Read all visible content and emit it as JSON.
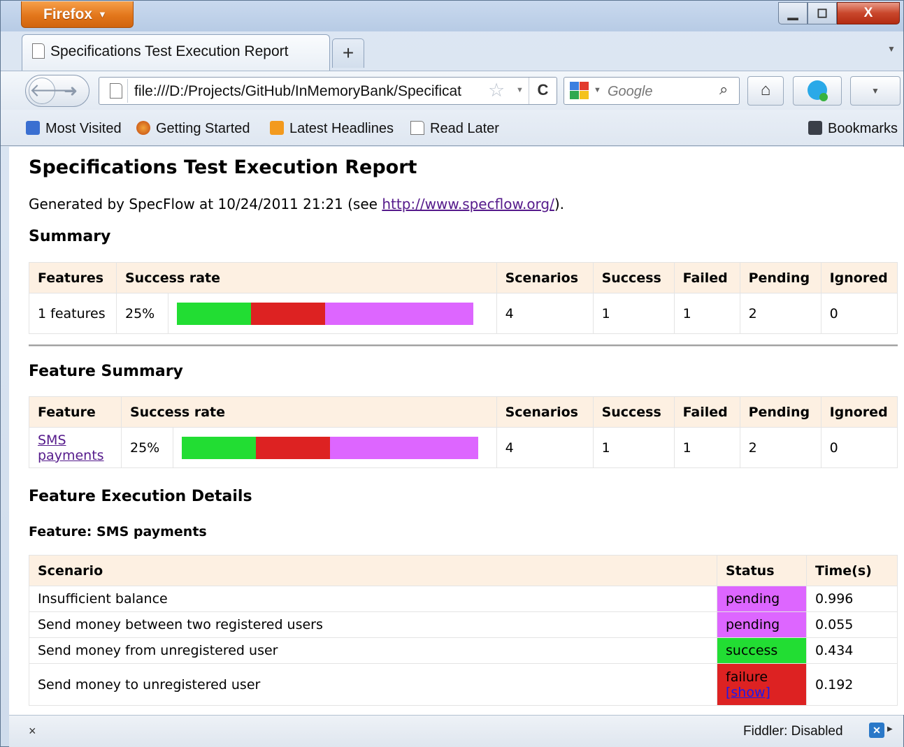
{
  "browser": {
    "menu_button": "Firefox",
    "window_controls": {
      "minimize": "▁",
      "maximize": "◻",
      "close": "X"
    },
    "tabs": [
      {
        "title": "Specifications Test Execution Report"
      }
    ],
    "new_tab": "+",
    "url": "file:///D:/Projects/GitHub/InMemoryBank/Specificat",
    "search_placeholder": "Google",
    "bookmarks": [
      {
        "label": "Most Visited",
        "icon": "most-visited-icon"
      },
      {
        "label": "Getting Started",
        "icon": "firefox-icon"
      },
      {
        "label": "Latest Headlines",
        "icon": "rss-icon"
      },
      {
        "label": "Read Later",
        "icon": "page-icon"
      }
    ],
    "bookmarks_menu": "Bookmarks",
    "status": {
      "close": "×",
      "fiddler": "Fiddler: Disabled"
    }
  },
  "report": {
    "title": "Specifications Test Execution Report",
    "generated_prefix": "Generated by SpecFlow at 10/24/2011 21:21 (see ",
    "generated_link": "http://www.specflow.org/",
    "generated_suffix": ").",
    "summary": {
      "heading": "Summary",
      "headers": [
        "Features",
        "Success rate",
        "Scenarios",
        "Success",
        "Failed",
        "Pending",
        "Ignored"
      ],
      "row": {
        "features": "1 features",
        "rate": "25%",
        "scenarios": "4",
        "success": "1",
        "failed": "1",
        "pending": "2",
        "ignored": "0"
      },
      "bar": {
        "success": 0.25,
        "failed": 0.25,
        "pending": 0.5
      }
    },
    "feature_summary": {
      "heading": "Feature Summary",
      "headers": [
        "Feature",
        "Success rate",
        "Scenarios",
        "Success",
        "Failed",
        "Pending",
        "Ignored"
      ],
      "row": {
        "feature": "SMS payments",
        "rate": "25%",
        "scenarios": "4",
        "success": "1",
        "failed": "1",
        "pending": "2",
        "ignored": "0"
      },
      "bar": {
        "success": 0.25,
        "failed": 0.25,
        "pending": 0.5
      }
    },
    "details": {
      "heading": "Feature Execution Details",
      "feature_heading": "Feature: SMS payments",
      "headers": [
        "Scenario",
        "Status",
        "Time(s)"
      ],
      "rows": [
        {
          "scenario": "Insufficient balance",
          "status": "pending",
          "time": "0.996"
        },
        {
          "scenario": "Send money between two registered users",
          "status": "pending",
          "time": "0.055"
        },
        {
          "scenario": "Send money from unregistered user",
          "status": "success",
          "time": "0.434"
        },
        {
          "scenario": "Send money to unregistered user",
          "status": "failure",
          "show": "[show]",
          "time": "0.192"
        }
      ]
    },
    "colors": {
      "success": "#22dd33",
      "failed": "#dd2222",
      "pending": "#dd66ff"
    }
  }
}
